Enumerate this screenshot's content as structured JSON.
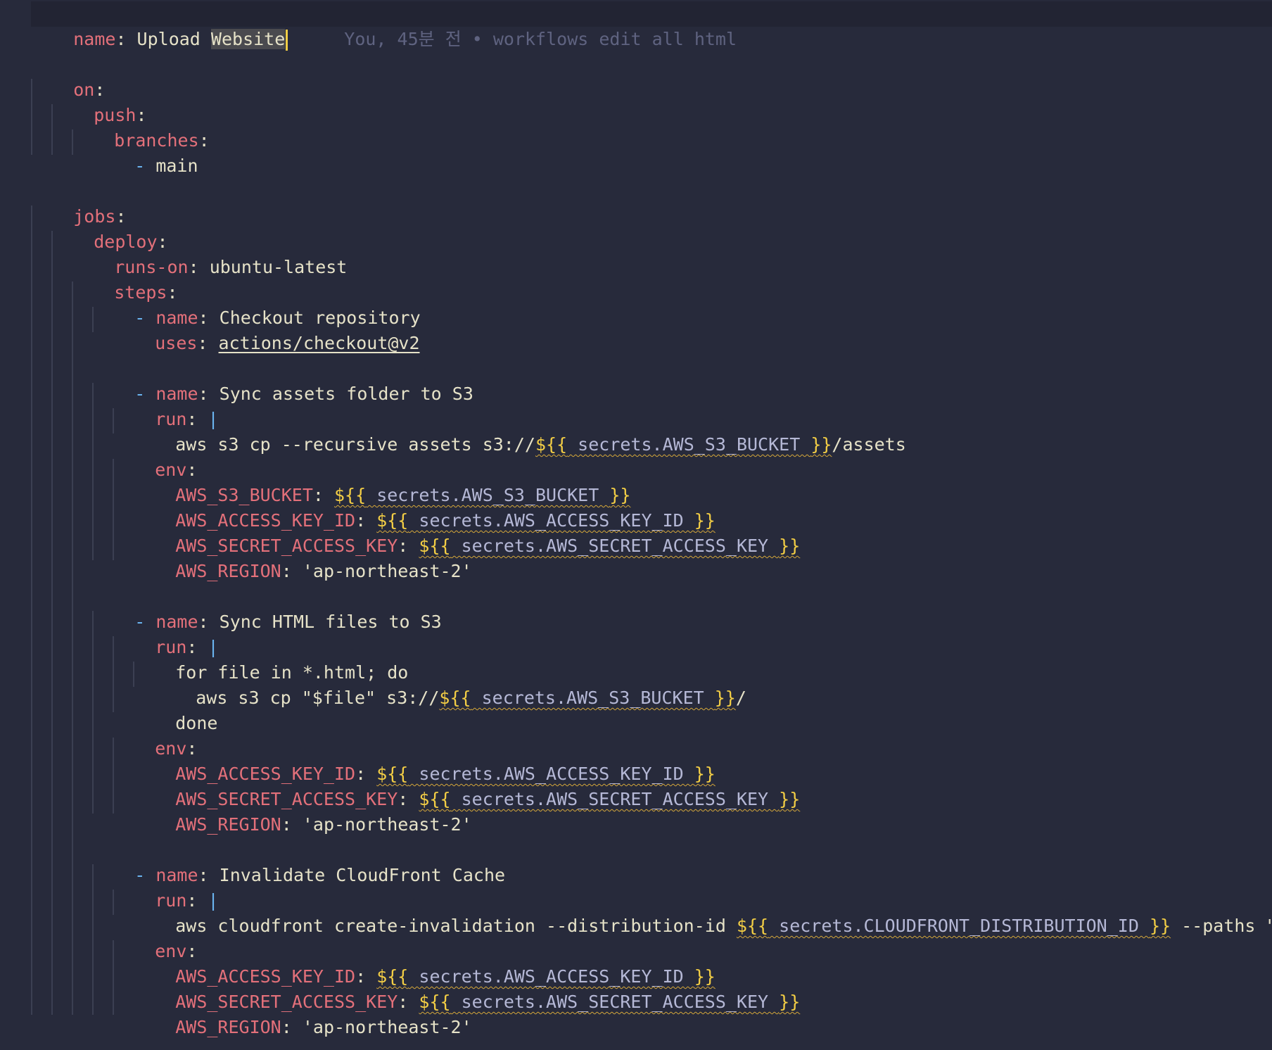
{
  "blame": "You, 45분 전 • workflows edit all html",
  "lines": {
    "l1": {
      "k": "name",
      "colon": ":",
      "v1": " Upload ",
      "v2": "Website"
    },
    "l3": {
      "k": "on",
      "colon": ":"
    },
    "l4": {
      "k": "push",
      "colon": ":"
    },
    "l5": {
      "k": "branches",
      "colon": ":"
    },
    "l6": {
      "dash": "- ",
      "v": "main"
    },
    "l8": {
      "k": "jobs",
      "colon": ":"
    },
    "l9": {
      "k": "deploy",
      "colon": ":"
    },
    "l10": {
      "k": "runs-on",
      "colon": ": ",
      "v": "ubuntu-latest"
    },
    "l11": {
      "k": "steps",
      "colon": ":"
    },
    "l12": {
      "dash": "- ",
      "k": "name",
      "colon": ": ",
      "v": "Checkout repository"
    },
    "l13": {
      "k": "uses",
      "colon": ": ",
      "v": "actions/checkout@v2"
    },
    "l15": {
      "dash": "- ",
      "k": "name",
      "colon": ": ",
      "v": "Sync assets folder to S3"
    },
    "l16": {
      "k": "run",
      "colon": ": ",
      "bar": "|"
    },
    "l17": {
      "pre": "aws s3 cp --recursive assets s3://",
      "open": "${{",
      "sec": " secrets.AWS_S3_BUCKET ",
      "close": "}}",
      "post": "/assets"
    },
    "l18": {
      "k": "env",
      "colon": ":"
    },
    "l19": {
      "k": "AWS_S3_BUCKET",
      "colon": ": ",
      "open": "${{",
      "sec": " secrets.AWS_S3_BUCKET ",
      "close": "}}"
    },
    "l20": {
      "k": "AWS_ACCESS_KEY_ID",
      "colon": ": ",
      "open": "${{",
      "sec": " secrets.AWS_ACCESS_KEY_ID ",
      "close": "}}"
    },
    "l21": {
      "k": "AWS_SECRET_ACCESS_KEY",
      "colon": ": ",
      "open": "${{",
      "sec": " secrets.AWS_SECRET_ACCESS_KEY ",
      "close": "}}"
    },
    "l22": {
      "k": "AWS_REGION",
      "colon": ": ",
      "v": "'ap-northeast-2'"
    },
    "l24": {
      "dash": "- ",
      "k": "name",
      "colon": ": ",
      "v": "Sync HTML files to S3"
    },
    "l25": {
      "k": "run",
      "colon": ": ",
      "bar": "|"
    },
    "l26": {
      "v": "for file in *.html; do"
    },
    "l27": {
      "pre": "aws s3 cp \"$file\" s3://",
      "open": "${{",
      "sec": " secrets.AWS_S3_BUCKET ",
      "close": "}}",
      "post": "/"
    },
    "l28": {
      "v": "done"
    },
    "l29": {
      "k": "env",
      "colon": ":"
    },
    "l30": {
      "k": "AWS_ACCESS_KEY_ID",
      "colon": ": ",
      "open": "${{",
      "sec": " secrets.AWS_ACCESS_KEY_ID ",
      "close": "}}"
    },
    "l31": {
      "k": "AWS_SECRET_ACCESS_KEY",
      "colon": ": ",
      "open": "${{",
      "sec": " secrets.AWS_SECRET_ACCESS_KEY ",
      "close": "}}"
    },
    "l32": {
      "k": "AWS_REGION",
      "colon": ": ",
      "v": "'ap-northeast-2'"
    },
    "l34": {
      "dash": "- ",
      "k": "name",
      "colon": ": ",
      "v": "Invalidate CloudFront Cache"
    },
    "l35": {
      "k": "run",
      "colon": ": ",
      "bar": "|"
    },
    "l36": {
      "pre": "aws cloudfront create-invalidation --distribution-id ",
      "open": "${{",
      "sec": " secrets.CLOUDFRONT_DISTRIBUTION_ID ",
      "close": "}}",
      "post": " --paths \"/*\""
    },
    "l37": {
      "k": "env",
      "colon": ":"
    },
    "l38": {
      "k": "AWS_ACCESS_KEY_ID",
      "colon": ": ",
      "open": "${{",
      "sec": " secrets.AWS_ACCESS_KEY_ID ",
      "close": "}}"
    },
    "l39": {
      "k": "AWS_SECRET_ACCESS_KEY",
      "colon": ": ",
      "open": "${{",
      "sec": " secrets.AWS_SECRET_ACCESS_KEY ",
      "close": "}}"
    },
    "l40": {
      "k": "AWS_REGION",
      "colon": ": ",
      "v": "'ap-northeast-2'"
    }
  },
  "colors": {
    "background": "#272a3b",
    "key": "#e3707a",
    "value": "#e6e2c8",
    "expression_brace": "#f2cd45",
    "secret_ref": "#b5b8d6",
    "list_dash": "#6ab4f0",
    "blame_text": "#5f6380"
  }
}
